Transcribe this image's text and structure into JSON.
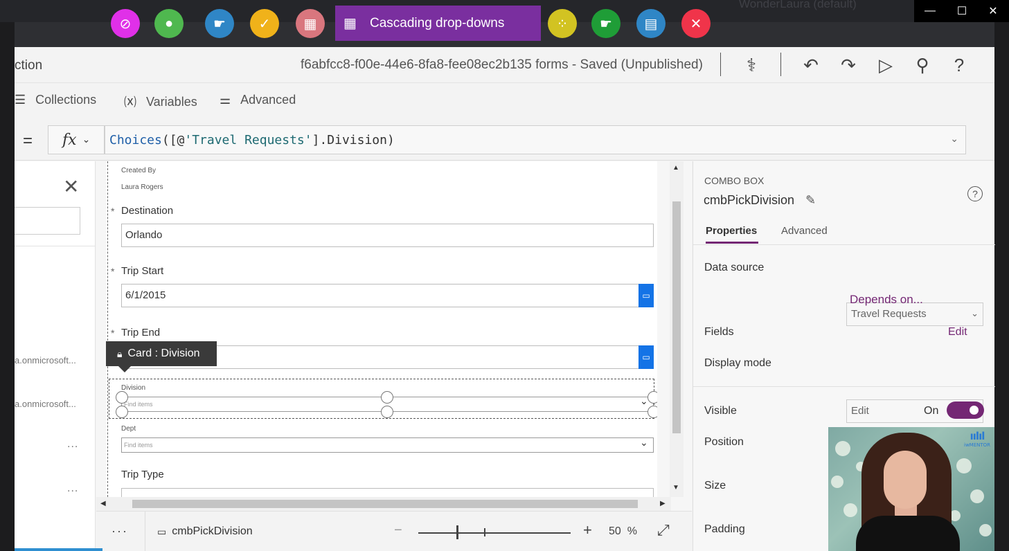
{
  "topbar": {
    "active_chip": "Cascading drop-downs",
    "wm_title": "WonderLaura (default)",
    "bubble_colors": [
      "#e030e8",
      "#4fb84f",
      "#2f86c6",
      "#f0b21a",
      "#d9767e",
      "#d2c322",
      "#1f9d37",
      "#2f86c6",
      "#f0344a",
      "#7a2f9f"
    ]
  },
  "header": {
    "left_title": "ction",
    "doc_title": "f6abfcc8-f00e-44e6-8fa8-fee08ec2b135 forms - Saved (Unpublished)"
  },
  "menu": {
    "collections": "Collections",
    "variables": "Variables",
    "advanced": "Advanced"
  },
  "formula": {
    "equals": "=",
    "fx": "fx",
    "fn_name": "Choices",
    "open": "([@",
    "string": "'Travel Requests'",
    "rest": "].Division)"
  },
  "left_panel": {
    "item1": "a.onmicrosoft...",
    "item2": "a.onmicrosoft...",
    "dots": "..."
  },
  "form": {
    "created_by_label": "Created By",
    "created_by_value": "Laura Rogers",
    "destination_label": "Destination",
    "destination_value": "Orlando",
    "trip_start_label": "Trip Start",
    "trip_start_value": "6/1/2015",
    "trip_end_label": "Trip End",
    "card_tag": "Card : Division",
    "division_label": "Division",
    "division_placeholder": "Find items",
    "dept_label": "Dept",
    "dept_placeholder": "Find items",
    "trip_type_label": "Trip Type",
    "required_mark": "*"
  },
  "status": {
    "selected_control": "cmbPickDivision",
    "zoom_minus": "−",
    "zoom_plus": "+",
    "zoom_value": "50",
    "zoom_unit": "%"
  },
  "right_panel": {
    "control_type": "COMBO BOX",
    "control_name": "cmbPickDivision",
    "tab_properties": "Properties",
    "tab_advanced": "Advanced",
    "data_source_label": "Data source",
    "data_source_value": "Travel Requests",
    "depends_on": "Depends on...",
    "fields_label": "Fields",
    "fields_edit": "Edit",
    "display_mode_label": "Display mode",
    "display_mode_value": "Edit",
    "visible_label": "Visible",
    "visible_value": "On",
    "position_label": "Position",
    "size_label": "Size",
    "padding_label": "Padding"
  },
  "video": {
    "logo_text": "iwMENTOR"
  }
}
